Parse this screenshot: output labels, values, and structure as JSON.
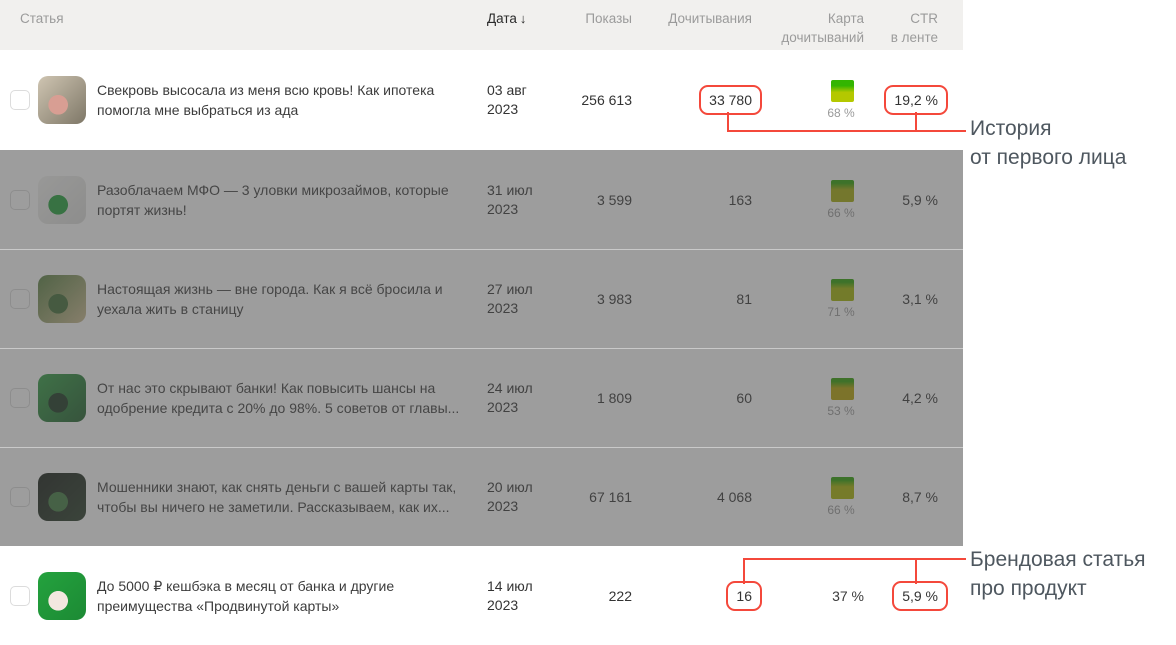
{
  "header": {
    "article": "Статья",
    "date": "Дата",
    "sort_icon": "↓",
    "impressions": "Показы",
    "reads": "Дочитывания",
    "map_line1": "Карта",
    "map_line2": "дочитываний",
    "ctr_line1": "CTR",
    "ctr_line2": "в ленте"
  },
  "rows": [
    {
      "title": "Свекровь высосала из меня всю кровь! Как ипотека помогла мне выбраться из ада",
      "date_day": "03 авг",
      "date_year": "2023",
      "impressions": "256 613",
      "reads": "33 780",
      "reads_circled": true,
      "has_map_square": true,
      "map_percent": "68 %",
      "map_colors": {
        "top": "#33b501",
        "body": "#b4c800",
        "green_band": 26
      },
      "ctr": "19,2 %",
      "ctr_circled": true,
      "dimmed": false,
      "thumb": {
        "base1": "#cfc5b2",
        "base2": "#7e7767",
        "accent": "#d89e93"
      }
    },
    {
      "title": "Разоблачаем МФО — 3 уловки микрозаймов, которые портят жизнь!",
      "date_day": "31 июл",
      "date_year": "2023",
      "impressions": "3 599",
      "reads": "163",
      "reads_circled": false,
      "has_map_square": true,
      "map_percent": "66 %",
      "map_colors": {
        "top": "#2aa000",
        "body": "#a4aa08",
        "green_band": 14
      },
      "ctr": "5,9 %",
      "ctr_circled": false,
      "dimmed": true,
      "thumb": {
        "base1": "#f4f4f2",
        "base2": "#dcdcda",
        "accent": "#21a038"
      }
    },
    {
      "title": "Настоящая жизнь — вне города. Как я всё бросила и уехала жить в станицу",
      "date_day": "27 июл",
      "date_year": "2023",
      "impressions": "3 983",
      "reads": "81",
      "reads_circled": false,
      "has_map_square": true,
      "map_percent": "71 %",
      "map_colors": {
        "top": "#2aa000",
        "body": "#a3b400",
        "green_band": 14
      },
      "ctr": "3,1 %",
      "ctr_circled": false,
      "dimmed": true,
      "thumb": {
        "base1": "#577f3f",
        "base2": "#cdbb90",
        "accent": "#3f6b33"
      }
    },
    {
      "title": "От нас это скрывают банки! Как повысить шансы на одобрение кредита с 20% до 98%. 5 советов от главы...",
      "date_day": "24 июл",
      "date_year": "2023",
      "impressions": "1 809",
      "reads": "60",
      "reads_circled": false,
      "has_map_square": true,
      "map_percent": "53 %",
      "map_colors": {
        "top": "#2f9e00",
        "body": "#b5a300",
        "green_band": 16
      },
      "ctr": "4,2 %",
      "ctr_circled": false,
      "dimmed": true,
      "thumb": {
        "base1": "#2f9e41",
        "base2": "#1d5c2a",
        "accent": "#17341d"
      }
    },
    {
      "title": "Мошенники знают, как снять деньги с вашей карты так, чтобы вы ничего не заметили. Рассказываем, как их...",
      "date_day": "20 июл",
      "date_year": "2023",
      "impressions": "67 161",
      "reads": "4 068",
      "reads_circled": false,
      "has_map_square": true,
      "map_percent": "66 %",
      "map_colors": {
        "top": "#2aa000",
        "body": "#a8b300",
        "green_band": 14
      },
      "ctr": "8,7 %",
      "ctr_circled": false,
      "dimmed": true,
      "thumb": {
        "base1": "#141a14",
        "base2": "#263a26",
        "accent": "#3f7a3f"
      }
    },
    {
      "title": "До 5000 ₽ кешбэка в месяц от банка и другие преимущества «Продвинутой карты»",
      "date_day": "14 июл",
      "date_year": "2023",
      "impressions": "222",
      "reads": "16",
      "reads_circled": true,
      "has_map_square": false,
      "map_percent": "37 %",
      "map_colors": null,
      "ctr": "5,9 %",
      "ctr_circled": true,
      "dimmed": false,
      "thumb": {
        "base1": "#24a23e",
        "base2": "#1c8a34",
        "accent": "#f3e7df"
      }
    }
  ],
  "annotations": [
    {
      "line1": "История",
      "line2": "от первого лица"
    },
    {
      "line1": "Брендовая статья",
      "line2": "про продукт"
    }
  ],
  "colors": {
    "accent_red": "#f4483b",
    "header_bg": "#f1f0ee",
    "dim_overlay": "#4d4d4d",
    "annotation_text": "#4e575f"
  }
}
